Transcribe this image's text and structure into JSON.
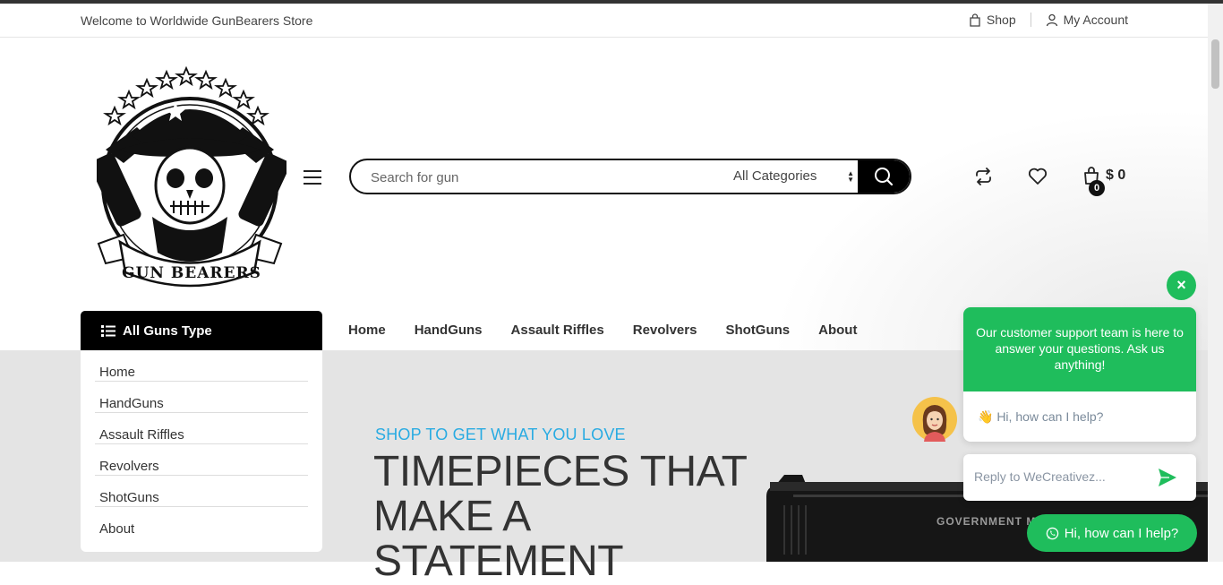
{
  "topbar": {
    "welcome": "Welcome to Worldwide GunBearers Store",
    "shop": "Shop",
    "account": "My Account"
  },
  "logo": {
    "text": "GUN BEARERS"
  },
  "search": {
    "placeholder": "Search for gun",
    "category": "All Categories"
  },
  "header": {
    "cart_count": "0",
    "cart_total": "$ 0"
  },
  "category_menu": {
    "title": "All Guns Type",
    "items": [
      "Home",
      "HandGuns",
      "Assault Riffles",
      "Revolvers",
      "ShotGuns",
      "About"
    ]
  },
  "nav": {
    "items": [
      "Home",
      "HandGuns",
      "Assault Riffles",
      "Revolvers",
      "ShotGuns",
      "About"
    ]
  },
  "hero": {
    "subtitle": "SHOP TO GET WHAT YOU LOVE",
    "title": "TIMEPIECES THAT MAKE A STATEMENT",
    "gun_text": "GOVERNMENT MODEL COLT"
  },
  "chat": {
    "close": "×",
    "message": "Our customer support team is here to answer your questions. Ask us anything!",
    "greeting": "👋 Hi, how can I help?",
    "reply_placeholder": "Reply to WeCreativez...",
    "pill_label": "Hi, how can I help?"
  },
  "colors": {
    "accent_green": "#1fbd5c",
    "accent_blue": "#29abe2"
  }
}
